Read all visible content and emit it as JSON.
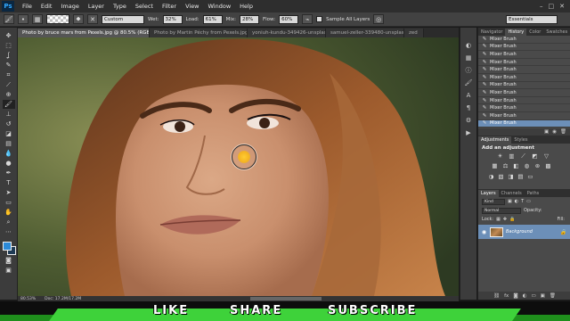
{
  "app": {
    "logo": "Ps",
    "menu": [
      "File",
      "Edit",
      "Image",
      "Layer",
      "Type",
      "Select",
      "Filter",
      "View",
      "Window",
      "Help"
    ],
    "window_controls": [
      "–",
      "□",
      "✕"
    ]
  },
  "options_bar": {
    "blend_mode": "Custom",
    "wet_label": "Wet:",
    "wet_value": "32%",
    "load_label": "Load:",
    "load_value": "61%",
    "mix_label": "Mix:",
    "mix_value": "28%",
    "flow_label": "Flow:",
    "flow_value": "60%",
    "sample_all_layers": "Sample All Layers",
    "workspace": "Essentials"
  },
  "documents": {
    "tabs": [
      "Photo by bruce mars from Pexels.jpg @ 80.5% (RGB/8) *",
      "Photo by Martin Péchy from Pexels.jpg",
      "yoniuh-kundu-349426-unsplash.jpg",
      "samuel-zeller-339480-unsplash.jpg",
      "zed"
    ],
    "active_index": 0
  },
  "status_bar": {
    "zoom": "80.53%",
    "doc_size": "Doc: 17.2M/17.2M"
  },
  "panels": {
    "history_tabs": [
      "Navigator",
      "History",
      "Color",
      "Swatches"
    ],
    "history_active": "History",
    "history_items": [
      "Mixer Brush",
      "Mixer Brush",
      "Mixer Brush",
      "Mixer Brush",
      "Mixer Brush",
      "Mixer Brush",
      "Mixer Brush",
      "Mixer Brush",
      "Mixer Brush",
      "Mixer Brush",
      "Mixer Brush",
      "Mixer Brush"
    ],
    "history_selected": 11,
    "adjust_tabs": [
      "Adjustments",
      "Styles"
    ],
    "adjust_title": "Add an adjustment",
    "layers_tabs": [
      "Layers",
      "Channels",
      "Paths"
    ],
    "kind_label": "Kind",
    "blend_mode": "Normal",
    "opacity_label": "Opacity:",
    "lock_label": "Lock:",
    "fill_label": "Fill:",
    "layer_name": "Background"
  },
  "banner": {
    "like": "LIKE",
    "share": "SHARE",
    "subscribe": "SUBSCRIBE"
  },
  "colors": {
    "brush_color": "#f4b321",
    "foreground": "#2c8ad8",
    "banner_green": "#3ed23a"
  }
}
